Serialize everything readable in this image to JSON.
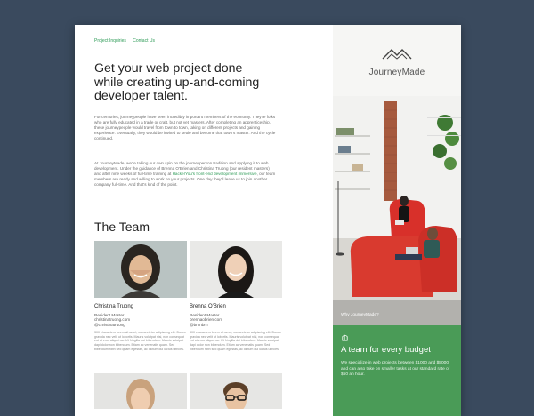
{
  "nav": {
    "items": [
      "Project Inquiries",
      "Contact Us"
    ]
  },
  "headline": "Get your web project done while creating up-and-coming developer talent.",
  "intro": {
    "p1": "For centuries, journeypeople have been incredibly important members of the economy. They're folks who are fully educated in a trade or craft, but not yet masters. After completing an apprenticeship, these journeypeople would travel from town to town, taking on different projects and gaining experience. Eventually, they would be invited to settle and become that town's master. And the cycle continued.",
    "p2a": "At JourneyMade, we're taking our own spin on the journeyperson tradition and applying it to web development. Under the guidance of Brenna O'Brien and Christina Truong (our resident masters) and after nine weeks of full-time training at",
    "p2_link": "HackerYou's front-end development immersive",
    "p2b": ", our team members are ready and willing to work on your projects. One day they'll leave us to join another company full-time. And that's kind of the point."
  },
  "team": {
    "title": "The Team",
    "members": [
      {
        "name": "Christina Truong",
        "role": "Resident Master",
        "site": "christinatruong.com",
        "handle": "@christinatruong",
        "bio": "300 characters lorem sit amet, consectetur adipiscing elit. Donec gravida nec velit ut lobortis. Mauris volutpat nisi, non consequat est ut eros aliquet ac. Ut fringilla dui bibendum. Mauris volutpat dapi dolor non bibendum. Etiam ac venenatis quam. Sed bibendum nibh sed quam egestas, ac dictum dui luctus ultrices."
      },
      {
        "name": "Brenna O'Brien",
        "role": "Resident Master",
        "site": "brennaobrien.com",
        "handle": "@brnnbrn",
        "bio": "300 characters lorem sit amet, consectetur adipiscing elit. Donec gravida nec velit ut lobortis. Mauris volutpat nisi, non consequat est ut eros aliquet ac. Ut fringilla dui bibendum. Mauris volutpat dapi dolor non bibendum. Etiam ac venenatis quam. Sed bibendum nibh sed quam egestas, ac dictum dui luctus ultrices."
      }
    ]
  },
  "sidebar": {
    "brand": "JourneyMade",
    "why_label": "Why JourneyMade?",
    "budget_title": "A team for every budget",
    "budget_text": "We specialize in web projects between $1000 and $5000, and can also take on smaller tasks at our standard rate of $50 an hour."
  },
  "colors": {
    "accent": "#2e9b57",
    "green_panel": "#4a9b57",
    "backdrop": "#3a4a5e"
  }
}
